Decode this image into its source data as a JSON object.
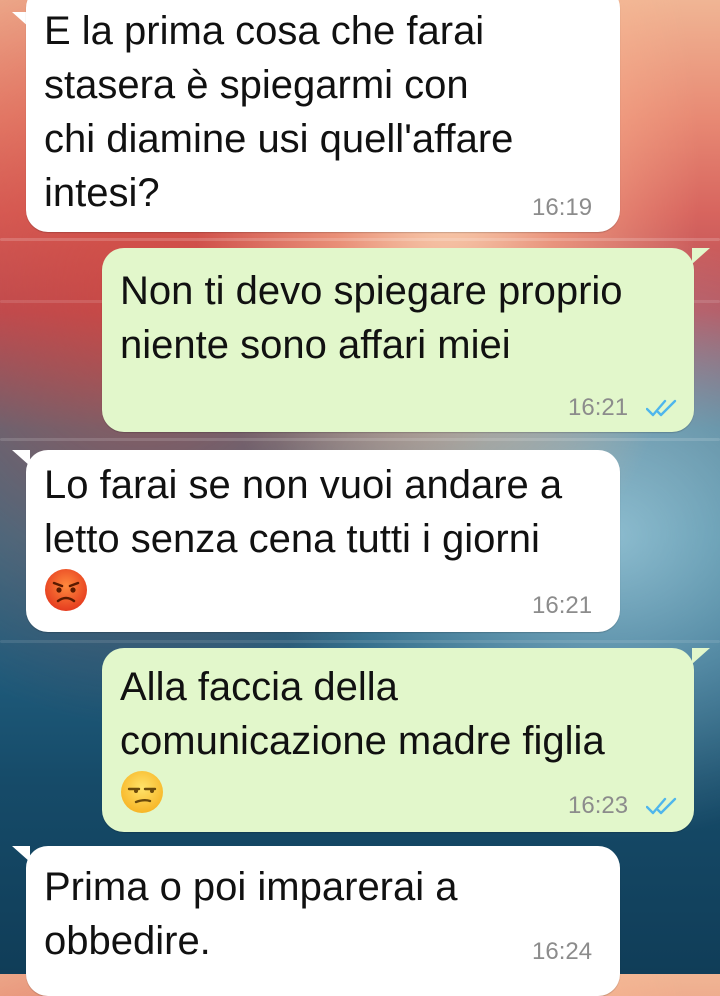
{
  "messages": [
    {
      "direction": "incoming",
      "text": "E la prima cosa che farai\nstasera è spiegarmi con\nchi diamine usi quell'affare\nintesi?",
      "time": "16:19"
    },
    {
      "direction": "outgoing",
      "text": "Non ti devo spiegare proprio\nniente sono affari miei",
      "time": "16:21",
      "status": "read",
      "ticks_color": "#4fb6ec"
    },
    {
      "direction": "incoming",
      "text": "Lo farai se non vuoi andare a\nletto senza cena tutti i giorni",
      "emoji": "angry-face-emoji",
      "time": "16:21"
    },
    {
      "direction": "outgoing",
      "text": "Alla faccia della\ncomunicazione madre figlia",
      "emoji": "unamused-face-emoji",
      "time": "16:23",
      "status": "read",
      "ticks_color": "#4fb6ec"
    },
    {
      "direction": "incoming",
      "text": "Prima o poi imparerai a\nobbedire.",
      "time": "16:24"
    }
  ],
  "colors": {
    "incoming_bubble": "#ffffff",
    "outgoing_bubble": "#e2f7cb",
    "timestamp": "#8c8c8c",
    "read_ticks": "#4fb6ec"
  }
}
